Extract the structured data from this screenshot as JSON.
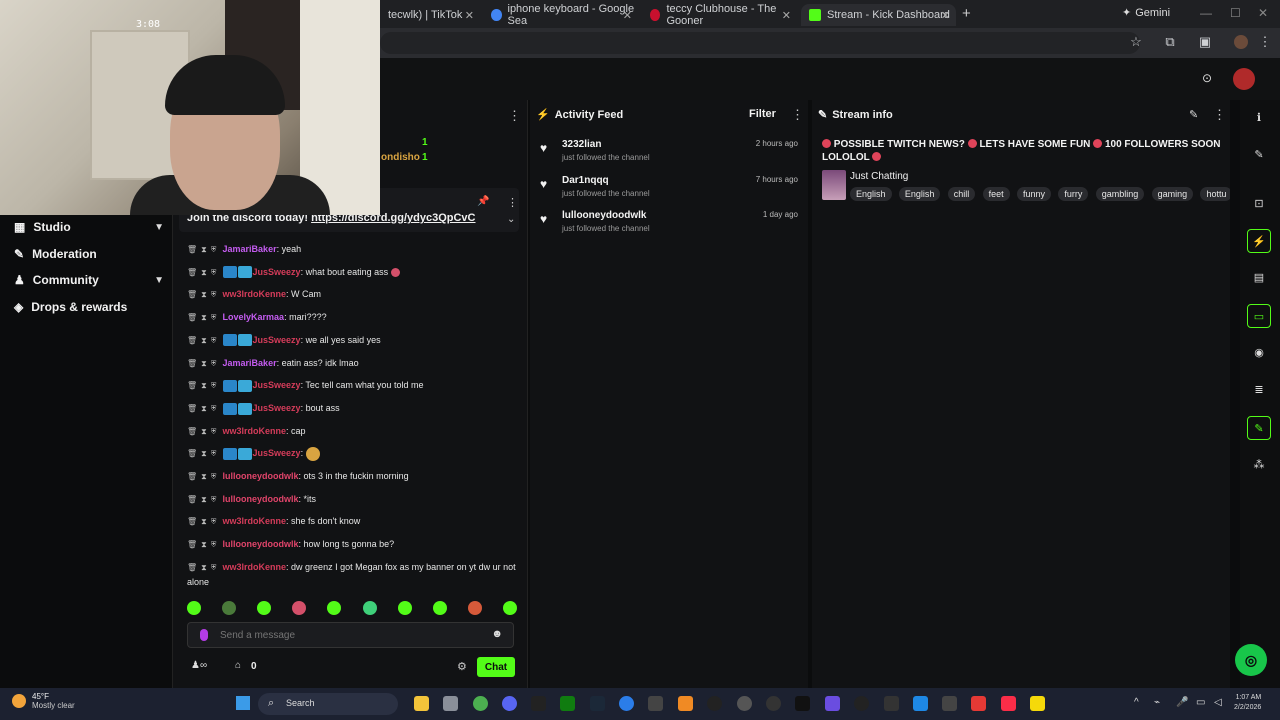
{
  "browser": {
    "tabs": [
      {
        "title": "tecwlk) | TikTok"
      },
      {
        "title": "iphone keyboard - Google Sea"
      },
      {
        "title": "teccy Clubhouse - The Gooner"
      },
      {
        "title": "Stream - Kick Dashboard"
      }
    ],
    "new_tab": "+",
    "gemini_label": "Gemini"
  },
  "webcam": {
    "timestamp": "3:08"
  },
  "nav": {
    "items": [
      {
        "label": "Studio"
      },
      {
        "label": "Moderation"
      },
      {
        "label": "Community"
      },
      {
        "label": "Drops & rewards"
      }
    ]
  },
  "chat": {
    "leaderboard": [
      {
        "name": "ondisho",
        "count": "1"
      },
      {
        "name": "",
        "count": "1"
      }
    ],
    "pinned_prefix": "Join the discord today! ",
    "pinned_link": "https://discord.gg/ydyc3QpCvC",
    "messages": [
      {
        "user": "JamariBaker",
        "color": "#c45cf0",
        "badges": 0,
        "text": ": yeah"
      },
      {
        "user": "JusSweezy",
        "color": "#d43c5a",
        "badges": 2,
        "text": ": what bout eating ass "
      },
      {
        "user": "ww3lrdoKenne",
        "color": "#d43c5a",
        "badges": 0,
        "text": ": W Cam"
      },
      {
        "user": "LovelyKarmaa",
        "color": "#c45cf0",
        "badges": 0,
        "text": ": mari????"
      },
      {
        "user": "JusSweezy",
        "color": "#d43c5a",
        "badges": 2,
        "text": ": we all yes said yes"
      },
      {
        "user": "JamariBaker",
        "color": "#c45cf0",
        "badges": 0,
        "text": ": eatin ass? idk lmao"
      },
      {
        "user": "JusSweezy",
        "color": "#d43c5a",
        "badges": 2,
        "text": ": Tec tell cam what you told me"
      },
      {
        "user": "JusSweezy",
        "color": "#d43c5a",
        "badges": 2,
        "text": ": bout ass"
      },
      {
        "user": "ww3lrdoKenne",
        "color": "#d43c5a",
        "badges": 0,
        "text": ": cap"
      },
      {
        "user": "JusSweezy",
        "color": "#d43c5a",
        "badges": 2,
        "text": ": "
      },
      {
        "user": "lullooneydoodwlk",
        "color": "#e0446a",
        "badges": 0,
        "text": ": ots 3 in the fuckin morning"
      },
      {
        "user": "lullooneydoodwlk",
        "color": "#e0446a",
        "badges": 0,
        "text": ": *its"
      },
      {
        "user": "ww3lrdoKenne",
        "color": "#d43c5a",
        "badges": 0,
        "text": ": she fs don't know"
      },
      {
        "user": "lullooneydoodwlk",
        "color": "#e0446a",
        "badges": 0,
        "text": ": how long ts gonna be?"
      },
      {
        "user": "ww3lrdoKenne",
        "color": "#d43c5a",
        "badges": 0,
        "text": ": dw greenz I got Megan fox as my banner on yt dw ur not alone"
      }
    ],
    "input_placeholder": "Send a message",
    "gift_count": "0",
    "chat_button": "Chat",
    "accent": "#53fc18"
  },
  "activity": {
    "title": "Activity Feed",
    "filter_label": "Filter",
    "items": [
      {
        "name": "3232lian",
        "action": "just followed the channel",
        "time": "2 hours ago"
      },
      {
        "name": "Dar1nqqq",
        "action": "just followed the channel",
        "time": "7 hours ago"
      },
      {
        "name": "lullooneydoodwlk",
        "action": "just followed the channel",
        "time": "1 day ago"
      }
    ]
  },
  "stream_info": {
    "title": "Stream info",
    "stream_title_parts": [
      "POSSIBLE TWITCH NEWS?",
      "LETS HAVE SOME FUN",
      "100 FOLLOWERS SOON LOLOLOL"
    ],
    "category": "Just Chatting",
    "tags": [
      "English",
      "English",
      "chill",
      "feet",
      "funny",
      "furry",
      "gambling",
      "gaming",
      "hottu"
    ]
  },
  "taskbar": {
    "temp": "45°F",
    "weather": "Mostly clear",
    "search_label": "Search",
    "time": "1:07 AM",
    "date": "2/2/2026"
  }
}
